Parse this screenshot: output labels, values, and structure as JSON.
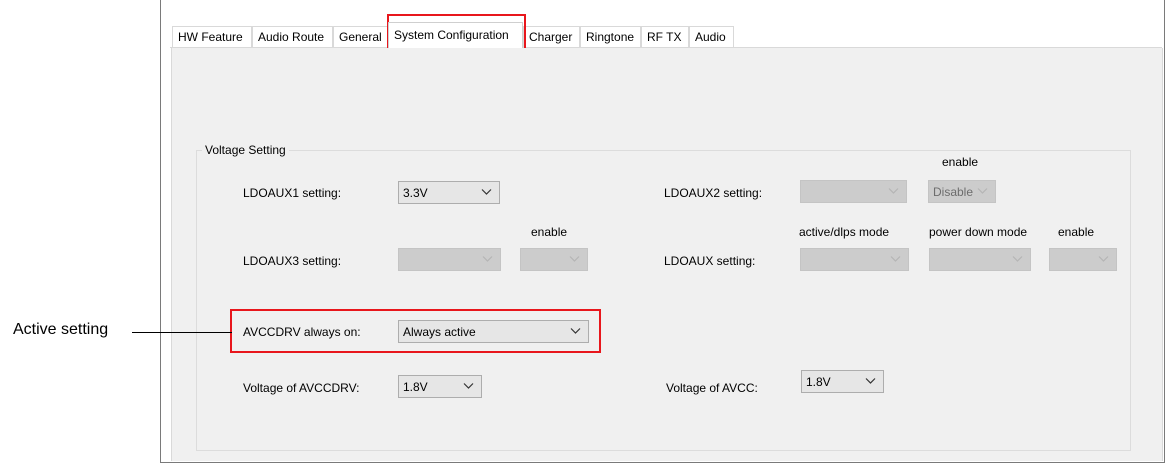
{
  "tabs": [
    {
      "label": "HW Feature"
    },
    {
      "label": "Audio Route"
    },
    {
      "label": "General"
    },
    {
      "label": "System Configuration",
      "selected": true
    },
    {
      "label": "Charger"
    },
    {
      "label": "Ringtone"
    },
    {
      "label": "RF TX"
    },
    {
      "label": "Audio"
    }
  ],
  "voltage_setting": {
    "group_title": "Voltage Setting",
    "ldoaux1": {
      "label": "LDOAUX1 setting:",
      "value": "3.3V"
    },
    "ldoaux2": {
      "label": "LDOAUX2 setting:",
      "enable_header": "enable",
      "value": "",
      "enable_value": "Disable"
    },
    "ldoaux3": {
      "label": "LDOAUX3 setting:",
      "enable_header": "enable",
      "value": "",
      "enable_value": ""
    },
    "ldoaux": {
      "label": "LDOAUX setting:",
      "active_header": "active/dlps mode",
      "power_down_header": "power down mode",
      "enable_header": "enable",
      "active_value": "",
      "power_down_value": "",
      "enable_value": ""
    },
    "avccdrv_always_on": {
      "label": "AVCCDRV always on:",
      "value": "Always active"
    },
    "avccdrv_voltage": {
      "label": "Voltage of AVCCDRV:",
      "value": "1.8V"
    },
    "avcc_voltage": {
      "label": "Voltage of AVCC:",
      "value": "1.8V"
    }
  },
  "annotation": {
    "text": "Active setting",
    "highlight_color": "#e8161c"
  },
  "icons": {
    "dropdown": "chevron-down-icon"
  }
}
